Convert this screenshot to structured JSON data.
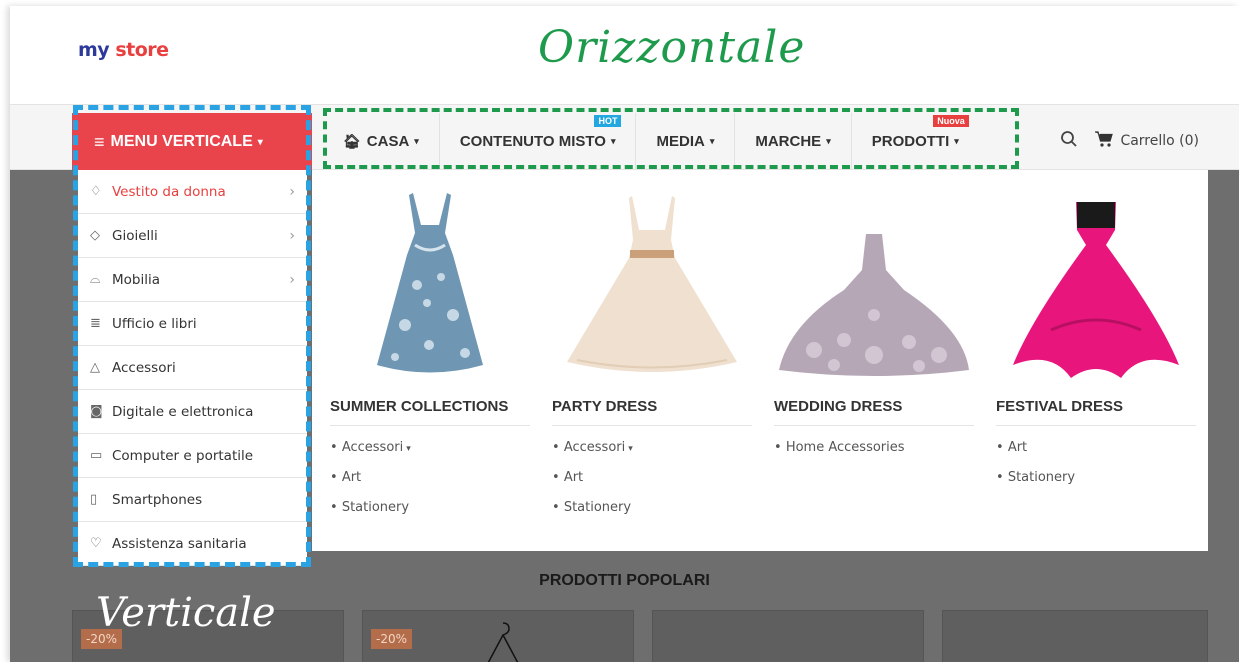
{
  "header": {
    "logo_my": "my",
    "logo_store": "store",
    "title": "Orizzontale"
  },
  "vertical_menu": {
    "button_label": "MENU VERTICALE",
    "items": [
      {
        "label": "Vestito da donna",
        "icon": "dress-icon",
        "has_submenu": true,
        "active": true
      },
      {
        "label": "Gioielli",
        "icon": "diamond-icon",
        "has_submenu": true
      },
      {
        "label": "Mobilia",
        "icon": "sofa-icon",
        "has_submenu": true
      },
      {
        "label": "Ufficio e libri",
        "icon": "books-icon",
        "has_submenu": false
      },
      {
        "label": "Accessori",
        "icon": "hanger-icon",
        "has_submenu": false
      },
      {
        "label": "Digitale e elettronica",
        "icon": "camera-icon",
        "has_submenu": false
      },
      {
        "label": "Computer e portatile",
        "icon": "laptop-icon",
        "has_submenu": false
      },
      {
        "label": "Smartphones",
        "icon": "smartphone-icon",
        "has_submenu": false
      },
      {
        "label": "Assistenza sanitaria",
        "icon": "heartbeat-icon",
        "has_submenu": false
      }
    ]
  },
  "horizontal_menu": {
    "items": [
      {
        "label": "CASA",
        "badge": ""
      },
      {
        "label": "CONTENUTO MISTO",
        "badge": "HOT"
      },
      {
        "label": "MEDIA",
        "badge": ""
      },
      {
        "label": "MARCHE",
        "badge": ""
      },
      {
        "label": "PRODOTTI",
        "badge": "Nuova"
      }
    ]
  },
  "tools": {
    "cart_label": "Carrello (0)"
  },
  "mega_menu": {
    "columns": [
      {
        "title": "SUMMER COLLECTIONS",
        "links": [
          "Accessori",
          "Art",
          "Stationery"
        ],
        "first_has_caret": true,
        "dress_color": "#6f97b3"
      },
      {
        "title": "PARTY DRESS",
        "links": [
          "Accessori",
          "Art",
          "Stationery"
        ],
        "first_has_caret": true,
        "dress_color": "#efe0cf"
      },
      {
        "title": "WEDDING DRESS",
        "links": [
          "Home Accessories"
        ],
        "first_has_caret": false,
        "dress_color": "#b5a7b6"
      },
      {
        "title": "FESTIVAL DRESS",
        "links": [
          "Art",
          "Stationery"
        ],
        "first_has_caret": false,
        "dress_color": "#e8157d"
      }
    ]
  },
  "popular": {
    "title": "PRODOTTI POPOLARI",
    "overlay_label": "Verticale",
    "discount_1": "-20%",
    "discount_2": "-20%"
  },
  "colors": {
    "accent_red": "#e9434b",
    "outline_blue": "#29a3e3",
    "outline_green": "#1e9a4c",
    "hot_badge": "#22a7e0"
  }
}
